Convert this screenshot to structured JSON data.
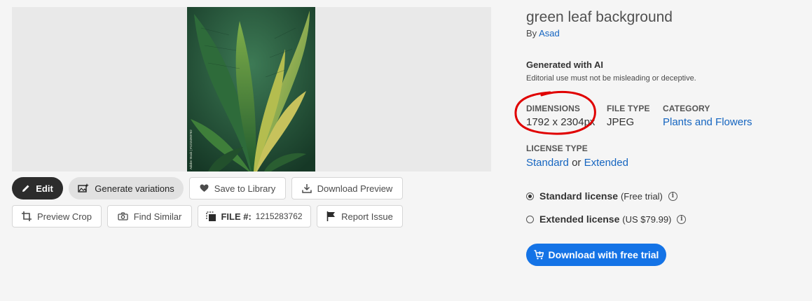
{
  "asset": {
    "title": "green leaf background",
    "by_prefix": "By",
    "author": "Asad",
    "ai_heading": "Generated with AI",
    "ai_note": "Editorial use must not be misleading or deceptive.",
    "image_watermark": "Adobe Stock | #1215283762"
  },
  "actions": {
    "edit": "Edit",
    "generate_variations": "Generate variations",
    "save_to_library": "Save to Library",
    "download_preview": "Download Preview",
    "preview_crop": "Preview Crop",
    "find_similar": "Find Similar",
    "file_label": "FILE #:",
    "file_number": "1215283762",
    "report_issue": "Report Issue"
  },
  "meta": {
    "dimensions_label": "DIMENSIONS",
    "dimensions_value": "1792 x 2304px",
    "file_type_label": "FILE TYPE",
    "file_type_value": "JPEG",
    "category_label": "CATEGORY",
    "category_value": "Plants and Flowers",
    "license_type_label": "LICENSE TYPE",
    "license_standard": "Standard",
    "license_or": "or",
    "license_extended": "Extended"
  },
  "license_options": {
    "standard_name": "Standard license",
    "standard_note": "(Free trial)",
    "extended_name": "Extended license",
    "extended_note": "(US $79.99)",
    "selected": "standard"
  },
  "download_button": "Download with free trial",
  "colors": {
    "accent": "#1473e6",
    "link": "#1565c0",
    "annotation": "#e00000",
    "dark_button": "#2c2c2c"
  }
}
